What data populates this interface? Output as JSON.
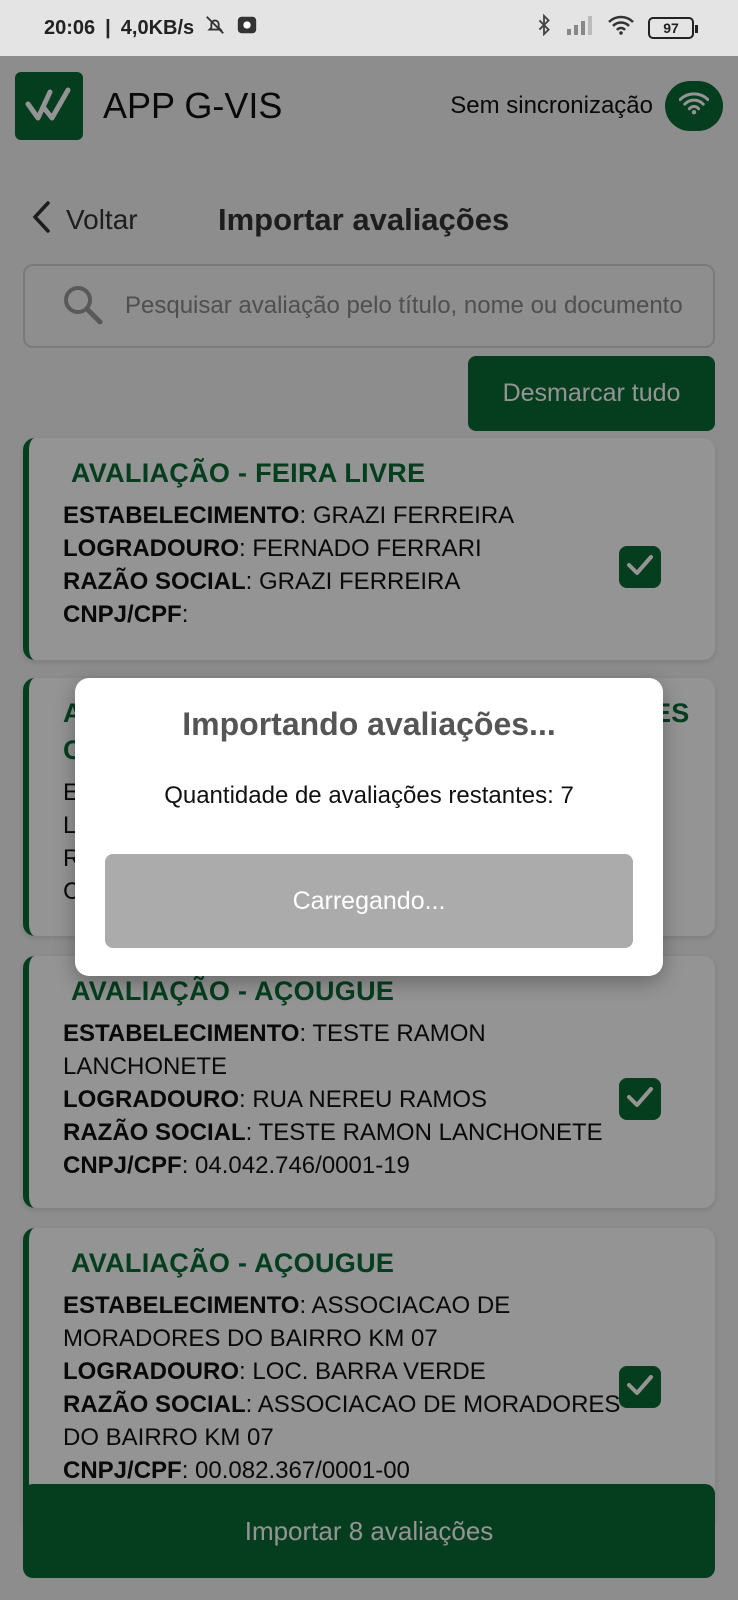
{
  "status_bar": {
    "time": "20:06",
    "speed": "4,0KB/s",
    "battery": "97"
  },
  "app": {
    "title": "APP G-VIS",
    "sync_label": "Sem sincronização"
  },
  "nav": {
    "back_label": "Voltar",
    "page_title": "Importar avaliações"
  },
  "search": {
    "placeholder": "Pesquisar avaliação pelo título, nome ou documento"
  },
  "unmark_all_label": "Desmarcar tudo",
  "cards": [
    {
      "title": "AVALIAÇÃO - FEIRA LIVRE",
      "estabelecimento_label": "ESTABELECIMENTO",
      "estabelecimento": "GRAZI FERREIRA",
      "logradouro_label": "LOGRADOURO",
      "logradouro": "FERNADO FERRARI",
      "razao_label": "RAZÃO SOCIAL",
      "razao": "GRAZI FERREIRA",
      "cnpj_label": "CNPJ/CPF",
      "cnpj": "",
      "checked": true
    },
    {
      "title": "AVALIAÇÃO - AÇOUGUE",
      "estabelecimento_label": "ESTABELECIMENTO",
      "estabelecimento": "TESTE RAMON LANCHONETE",
      "logradouro_label": "LOGRADOURO",
      "logradouro": "RUA NEREU RAMOS",
      "razao_label": "RAZÃO SOCIAL",
      "razao": "TESTE RAMON LANCHONETE",
      "cnpj_label": "CNPJ/CPF",
      "cnpj": "04.042.746/0001-19",
      "checked": true
    },
    {
      "title": "AVALIAÇÃO - AÇOUGUE",
      "estabelecimento_label": "ESTABELECIMENTO",
      "estabelecimento": "ASSOCIACAO DE MORADORES DO BAIRRO KM 07",
      "logradouro_label": "LOGRADOURO",
      "logradouro": "LOC. BARRA VERDE",
      "razao_label": "RAZÃO SOCIAL",
      "razao": "ASSOCIACAO DE MORADORES DO BAIRRO KM 07",
      "cnpj_label": "CNPJ/CPF",
      "cnpj": "00.082.367/0001-00",
      "checked": true
    }
  ],
  "hidden_card": {
    "title_fragments": [
      "A",
      "C",
      "ES"
    ],
    "label_fragments": [
      "E",
      "L",
      "R",
      "C"
    ]
  },
  "import_button_label": "Importar 8 avaliações",
  "dialog": {
    "title": "Importando avaliações...",
    "message": "Quantidade de avaliações restantes: 7",
    "button_label": "Carregando..."
  },
  "colors": {
    "primary": "#0a6b35",
    "disabled_button": "#ababab"
  }
}
